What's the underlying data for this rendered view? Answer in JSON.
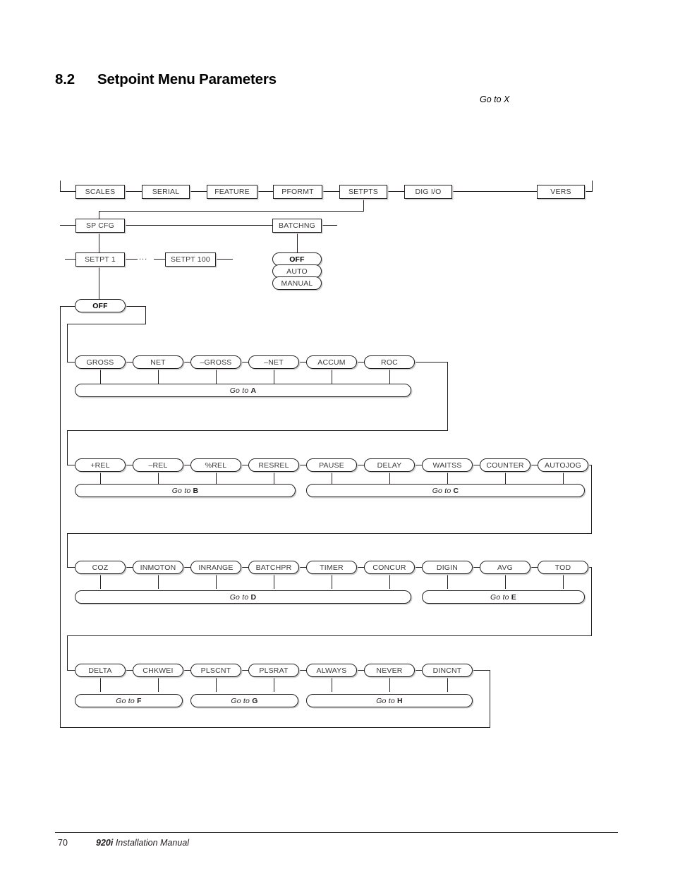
{
  "page": {
    "heading_number": "8.2",
    "heading_title": "Setpoint Menu Parameters",
    "goto_x": "Go to X",
    "footer_page_number": "70",
    "footer_model": "920i",
    "footer_title": " Installation Manual"
  },
  "diagram": {
    "ellipsis": "...",
    "top_menu": [
      {
        "label": "SCALES"
      },
      {
        "label": "SERIAL"
      },
      {
        "label": "FEATURE"
      },
      {
        "label": "PFORMT"
      },
      {
        "label": "SETPTS"
      },
      {
        "label": "DIG I/O"
      },
      {
        "label": "VERS"
      }
    ],
    "setpts_children": [
      {
        "label": "SP CFG"
      },
      {
        "label": "BATCHNG"
      }
    ],
    "setpt_range": [
      {
        "label": "SETPT 1"
      },
      {
        "label": "SETPT 100"
      }
    ],
    "batching_options": [
      {
        "label": "OFF",
        "bold": true
      },
      {
        "label": "AUTO",
        "bold": false
      },
      {
        "label": "MANUAL",
        "bold": false
      }
    ],
    "kind_off": {
      "label": "OFF",
      "bold": true
    },
    "row_a": {
      "items": [
        "GROSS",
        "NET",
        "–GROSS",
        "–NET",
        "ACCUM",
        "ROC"
      ],
      "goto": "Go to ",
      "goto_ref": "A"
    },
    "row_b": {
      "items": [
        "+REL",
        "–REL",
        "%REL",
        "RESREL"
      ],
      "goto": "Go to ",
      "goto_ref": "B"
    },
    "row_c": {
      "items": [
        "PAUSE",
        "DELAY",
        "WAITSS",
        "COUNTER",
        "AUTOJOG"
      ],
      "goto": "Go to ",
      "goto_ref": "C"
    },
    "row_d": {
      "items": [
        "COZ",
        "INMOTON",
        "INRANGE",
        "BATCHPR",
        "TIMER",
        "CONCUR"
      ],
      "goto": "Go to ",
      "goto_ref": "D"
    },
    "row_e": {
      "items": [
        "DIGIN",
        "AVG",
        "TOD"
      ],
      "goto": "Go to ",
      "goto_ref": "E"
    },
    "row_f": {
      "items": [
        "DELTA",
        "CHKWEI"
      ],
      "goto": "Go to ",
      "goto_ref": "F"
    },
    "row_g": {
      "items": [
        "PLSCNT",
        "PLSRAT"
      ],
      "goto": "Go to ",
      "goto_ref": "G"
    },
    "row_h": {
      "items": [
        "ALWAYS",
        "NEVER",
        "DINCNT"
      ],
      "goto": "Go to ",
      "goto_ref": "H"
    }
  }
}
